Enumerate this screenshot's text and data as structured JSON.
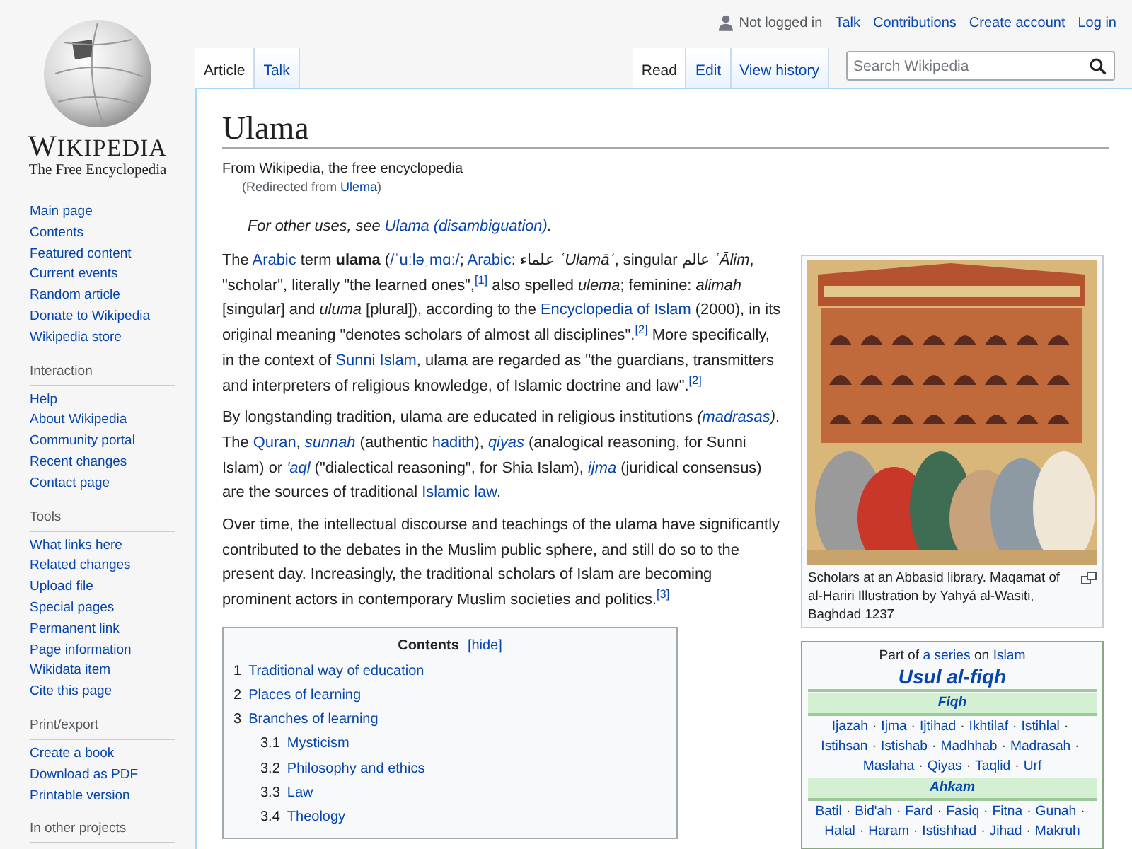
{
  "sidebar": {
    "logo": {
      "wordmark": "WIKIPEDIA",
      "tagline": "The Free Encyclopedia"
    },
    "sections": [
      {
        "items": [
          "Main page",
          "Contents",
          "Featured content",
          "Current events",
          "Random article",
          "Donate to Wikipedia",
          "Wikipedia store"
        ]
      },
      {
        "heading": "Interaction",
        "items": [
          "Help",
          "About Wikipedia",
          "Community portal",
          "Recent changes",
          "Contact page"
        ]
      },
      {
        "heading": "Tools",
        "items": [
          "What links here",
          "Related changes",
          "Upload file",
          "Special pages",
          "Permanent link",
          "Page information",
          "Wikidata item",
          "Cite this page"
        ]
      },
      {
        "heading": "Print/export",
        "items": [
          "Create a book",
          "Download as PDF",
          "Printable version"
        ]
      },
      {
        "heading": "In other projects"
      }
    ]
  },
  "personal": {
    "status": "Not logged in",
    "links": [
      "Talk",
      "Contributions",
      "Create account",
      "Log in"
    ]
  },
  "tabs_left": [
    {
      "label": "Article",
      "selected": true
    },
    {
      "label": "Talk",
      "selected": false
    }
  ],
  "tabs_right": [
    {
      "label": "Read",
      "selected": true
    },
    {
      "label": "Edit",
      "selected": false
    },
    {
      "label": "View history",
      "selected": false
    }
  ],
  "search": {
    "placeholder": "Search Wikipedia"
  },
  "article": {
    "title": "Ulama",
    "subtitle": "From Wikipedia, the free encyclopedia",
    "redirect": [
      {
        "kind": "plain",
        "text": "(Redirected from "
      },
      {
        "kind": "link",
        "text": "Ulema"
      },
      {
        "kind": "plain",
        "text": ")"
      }
    ],
    "hatnote": [
      {
        "kind": "plain",
        "text": "For other uses, see "
      },
      {
        "kind": "link",
        "text": "Ulama (disambiguation)"
      },
      {
        "kind": "plain",
        "text": "."
      }
    ],
    "paragraphs": [
      [
        {
          "kind": "plain",
          "text": "The "
        },
        {
          "kind": "link",
          "text": "Arabic"
        },
        {
          "kind": "plain",
          "text": " term **ulama** ("
        },
        {
          "kind": "link",
          "text": "/ˈuːləˌmɑː/"
        },
        {
          "kind": "plain",
          "text": "; "
        },
        {
          "kind": "link",
          "text": "Arabic"
        },
        {
          "kind": "plain",
          "text": ": علماء *ʿUlamāʾ*, singular عالم *ʿĀlim*, \"scholar\", literally \"the learned ones\","
        },
        {
          "kind": "link",
          "text": "$^{[1]}$"
        },
        {
          "kind": "plain",
          "text": " also spelled *ulema*; feminine: *alimah* [singular] and *uluma* [plural]), according to the "
        },
        {
          "kind": "link",
          "text": "Encyclopedia of Islam"
        },
        {
          "kind": "plain",
          "text": " (2000), in its original meaning \"denotes scholars of almost all disciplines\"."
        },
        {
          "kind": "link",
          "text": "$^{[2]}$"
        },
        {
          "kind": "plain",
          "text": " More specifically, in the context of "
        },
        {
          "kind": "link",
          "text": "Sunni Islam"
        },
        {
          "kind": "plain",
          "text": ", ulama are regarded as \"the guardians, transmitters and interpreters of religious knowledge, of Islamic doctrine and law\"."
        },
        {
          "kind": "link",
          "text": "$^{[2]}$"
        }
      ],
      [
        {
          "kind": "plain",
          "text": "By longstanding tradition, ulama are educated in religious institutions *(*"
        },
        {
          "kind": "link",
          "text": "*madrasas*"
        },
        {
          "kind": "plain",
          "text": "*)*. The "
        },
        {
          "kind": "link",
          "text": "Quran"
        },
        {
          "kind": "plain",
          "text": ", "
        },
        {
          "kind": "link",
          "text": "*sunnah*"
        },
        {
          "kind": "plain",
          "text": " (authentic "
        },
        {
          "kind": "link",
          "text": "hadith"
        },
        {
          "kind": "plain",
          "text": "), "
        },
        {
          "kind": "link",
          "text": "*qiyas*"
        },
        {
          "kind": "plain",
          "text": " (analogical reasoning, for Sunni Islam) or "
        },
        {
          "kind": "link",
          "text": "*'aql*"
        },
        {
          "kind": "plain",
          "text": " (\"dialectical reasoning\", for Shia Islam), "
        },
        {
          "kind": "link",
          "text": "*ijma*"
        },
        {
          "kind": "plain",
          "text": " (juridical consensus) are the sources of traditional "
        },
        {
          "kind": "link",
          "text": "Islamic law"
        },
        {
          "kind": "plain",
          "text": "."
        }
      ],
      [
        {
          "kind": "plain",
          "text": "Over time, the intellectual discourse and teachings of the ulama have significantly contributed to the debates in the Muslim public sphere, and still do so to the present day. Increasingly, the traditional scholars of Islam are becoming prominent actors in contemporary Muslim societies and politics."
        },
        {
          "kind": "link",
          "text": "$^{[3]}$"
        }
      ]
    ],
    "contents": {
      "title": "Contents",
      "toggle": "[hide]",
      "items": [
        {
          "number": "1",
          "title": "Traditional way of education"
        },
        {
          "number": "2",
          "title": "Places of learning"
        },
        {
          "number": "3",
          "title": "Branches of learning",
          "children": [
            {
              "number": "3.1",
              "title": "Mysticism"
            },
            {
              "number": "3.2",
              "title": "Philosophy and ethics"
            },
            {
              "number": "3.3",
              "title": "Law"
            },
            {
              "number": "3.4",
              "title": "Theology"
            }
          ]
        }
      ]
    },
    "image": {
      "kind": "picture",
      "caption": "Scholars at an Abbasid library. Maqamat of al-Hariri Illustration by Yahyá al-Wasiti, Baghdad 1237"
    },
    "infobox": {
      "intro": [
        {
          "kind": "plain",
          "text": "Part of "
        },
        {
          "kind": "link",
          "text": "a series"
        },
        {
          "kind": "plain",
          "text": " on "
        },
        {
          "kind": "link",
          "text": "Islam"
        }
      ],
      "title": "Usul al-fiqh",
      "separator": "·",
      "sections": [
        {
          "heading": "Fiqh",
          "items": [
            "Ijazah",
            "Ijma",
            "Ijtihad",
            "Ikhtilaf",
            "Istihlal",
            "Istihsan",
            "Istishab",
            "Madhhab",
            "Madrasah",
            "Maslaha",
            "Qiyas",
            "Taqlid",
            "Urf"
          ]
        },
        {
          "heading": "Ahkam",
          "items": [
            "Batil",
            "Bid'ah",
            "Fard",
            "Fasiq",
            "Fitna",
            "Gunah",
            "Halal",
            "Haram",
            "Istishhad",
            "Jihad",
            "Makruh"
          ]
        }
      ]
    }
  }
}
